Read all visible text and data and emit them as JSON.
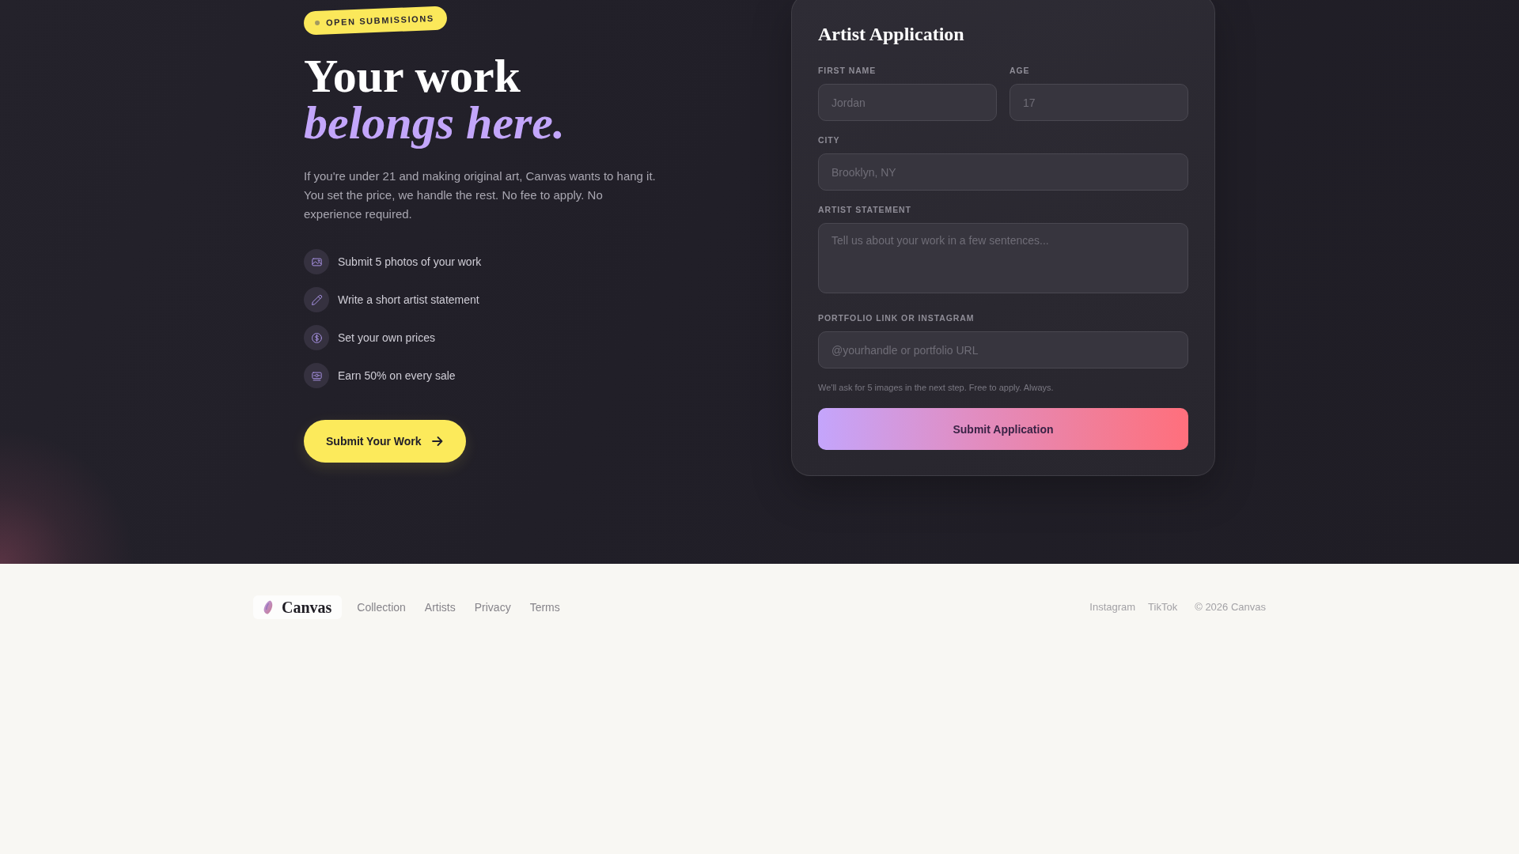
{
  "hero": {
    "badge": {
      "label": "OPEN SUBMISSIONS"
    },
    "headline": [
      {
        "text": "Your work",
        "kind": "plain"
      },
      {
        "text": "belongs here.",
        "kind": "accent"
      }
    ],
    "intro": "If you're under 21 and making original art, Canvas wants to hang it. You set the price, we handle the rest. No fee to apply. No experience required.",
    "features": [
      "Submit 5 photos of your work",
      "Write a short artist statement",
      "Set your own prices",
      "Earn 50% on every sale"
    ],
    "cta": {
      "label": "Submit Your Work"
    }
  },
  "application_form": {
    "title": "Artist Application",
    "rows": [
      [
        {
          "label": "FIRST NAME",
          "kind": "input",
          "placeholder": "Jordan"
        },
        {
          "label": "AGE",
          "kind": "input",
          "placeholder": "17"
        }
      ],
      [
        {
          "label": "CITY",
          "kind": "input",
          "placeholder": "Brooklyn, NY"
        }
      ],
      [
        {
          "label": "ARTIST STATEMENT",
          "kind": "textarea",
          "placeholder": "Tell us about your work in a few sentences..."
        }
      ],
      [
        {
          "label": "PORTFOLIO LINK OR INSTAGRAM",
          "kind": "input",
          "placeholder": "@yourhandle or portfolio URL"
        }
      ]
    ],
    "note": "We'll ask for 5 images in the next step. Free to apply. Always.",
    "submit": {
      "label": "Submit Application"
    }
  },
  "footer": {
    "brand": "Canvas",
    "links": [
      "Collection",
      "Artists",
      "Privacy",
      "Terms"
    ],
    "social": [
      "Instagram",
      "TikTok"
    ],
    "copyright": "© 2026 Canvas"
  }
}
